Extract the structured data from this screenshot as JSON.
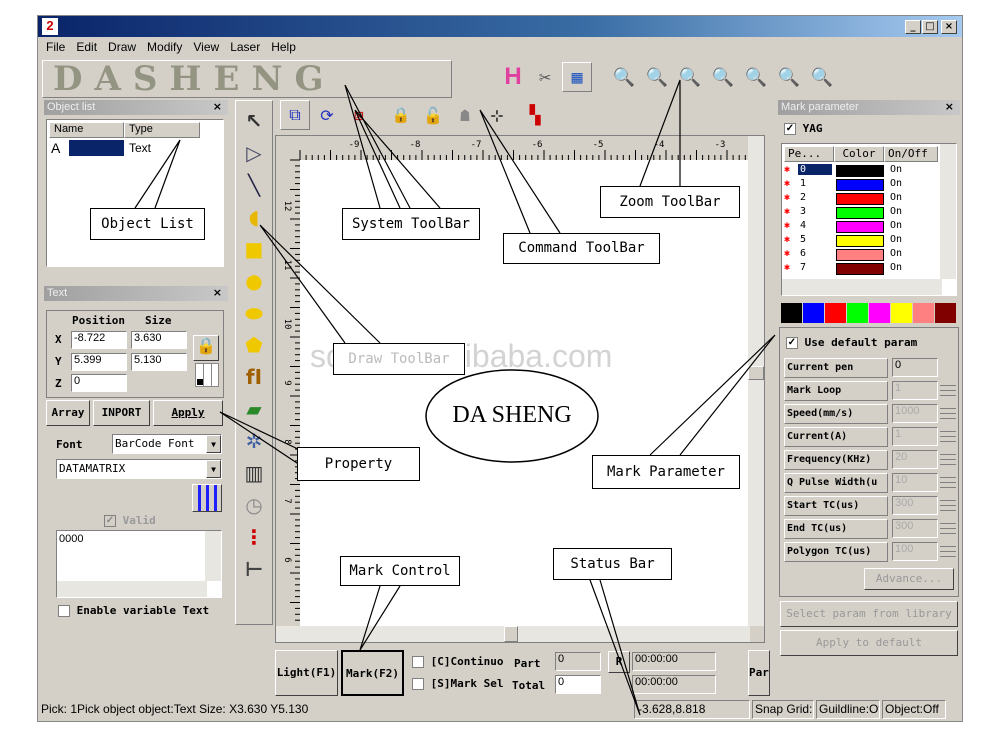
{
  "window": {
    "icon_text": "2",
    "controls": [
      "_",
      "□",
      "×"
    ]
  },
  "menu": [
    "File",
    "Edit",
    "Draw",
    "Modify",
    "View",
    "Laser",
    "Help"
  ],
  "toolbar": {
    "logo_letters": "DASHENG",
    "zoom_icons": [
      "zoom-icon",
      "zoom-in-icon",
      "zoom-plus-icon",
      "zoom-out-icon",
      "zoom-all-icon",
      "zoom-window-icon",
      "zoom-fit-icon"
    ]
  },
  "object_list": {
    "title": "Object list",
    "columns": [
      "Name",
      "Type"
    ],
    "rows": [
      {
        "name": "A",
        "type": "Text"
      }
    ]
  },
  "text_panel": {
    "title": "Text",
    "position_label": "Position",
    "size_label": "Size",
    "x_label": "X",
    "y_label": "Y",
    "z_label": "Z",
    "x_pos": "-8.722",
    "x_size": "3.630",
    "y_pos": "5.399",
    "y_size": "5.130",
    "z_pos": "0",
    "array": "Array",
    "import": "INPORT",
    "apply": "Apply",
    "font_label": "Font",
    "font_value": "BarCode Font",
    "barcode_value": "DATAMATRIX",
    "valid": "Valid",
    "text_value": "0000",
    "enable_variable": "Enable variable Text"
  },
  "ruler": {
    "top": [
      "-9",
      "-8",
      "-7",
      "-6",
      "-5",
      "-4",
      "-3"
    ],
    "left": [
      "12",
      "11",
      "10",
      "9",
      "8",
      "7",
      "6"
    ]
  },
  "mark_control": {
    "light": "Light(F1)",
    "mark": "Mark(F2)",
    "continuo": "[C]Continuo",
    "mark_sel": "[S]Mark Sel",
    "part_label": "Part",
    "total_label": "Total",
    "part_value": "0",
    "total_value": "0",
    "r_button": "R",
    "time1": "00:00:00",
    "time2": "00:00:00",
    "par": "Par"
  },
  "mark_param": {
    "title": "Mark parameter",
    "yag": "YAG",
    "columns": [
      "Pe...",
      "Color",
      "On/Off"
    ],
    "pens": [
      {
        "id": "0",
        "color": "#000000",
        "state": "On"
      },
      {
        "id": "1",
        "color": "#0000ff",
        "state": "On"
      },
      {
        "id": "2",
        "color": "#ff0000",
        "state": "On"
      },
      {
        "id": "3",
        "color": "#00ff00",
        "state": "On"
      },
      {
        "id": "4",
        "color": "#ff00ff",
        "state": "On"
      },
      {
        "id": "5",
        "color": "#ffff00",
        "state": "On"
      },
      {
        "id": "6",
        "color": "#ff8080",
        "state": "On"
      },
      {
        "id": "7",
        "color": "#800000",
        "state": "On"
      }
    ],
    "palette": [
      "#000000",
      "#0000ff",
      "#ff0000",
      "#00ff00",
      "#ff00ff",
      "#ffff00",
      "#ff8080",
      "#800000"
    ],
    "use_default": "Use default param",
    "params": [
      {
        "label": "Current pen",
        "value": "0"
      },
      {
        "label": "Mark Loop",
        "value": "1"
      },
      {
        "label": "Speed(mm/s)",
        "value": "1000"
      },
      {
        "label": "Current(A)",
        "value": "1"
      },
      {
        "label": "Frequency(KHz)",
        "value": "20"
      },
      {
        "label": "Q Pulse Width(u",
        "value": "10"
      },
      {
        "label": "Start TC(us)",
        "value": "300"
      },
      {
        "label": "End TC(us)",
        "value": "300"
      },
      {
        "label": "Polygon TC(us)",
        "value": "100"
      }
    ],
    "advance": "Advance...",
    "select_lib": "Select param from library",
    "apply_default": "Apply to default"
  },
  "status": {
    "message": "Pick: 1Pick object object:Text Size: X3.630 Y5.130",
    "coords": "-3.628,8.818",
    "snap": "Snap Grid:(",
    "guide": "Guildline:Of",
    "object": "Object:Off"
  },
  "annotations": {
    "object_list": "Object List",
    "system_toolbar": "System ToolBar",
    "command_toolbar": "Command ToolBar",
    "zoom_toolbar": "Zoom ToolBar",
    "draw_toolbar": "Draw ToolBar",
    "property": "Property",
    "mark_parameter": "Mark Parameter",
    "mark_control": "Mark Control",
    "status_bar": "Status Bar",
    "logo": "DA SHENG",
    "watermark": "sdddsen.alibaba.com"
  }
}
